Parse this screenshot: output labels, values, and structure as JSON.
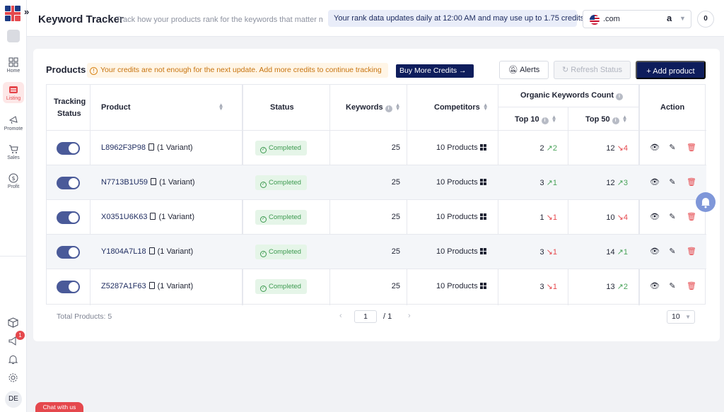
{
  "app": {
    "title": "Keyword Tracker",
    "subtitle": "Track how your products rank for the keywords that matter mc",
    "info": "Your rank data updates daily at 12:00 AM and may use up to 1.75 credits.",
    "marketplace": ".com",
    "marketplace_logo": "a",
    "counter": "0"
  },
  "sidebar": {
    "items": [
      {
        "label": "Home",
        "icon": "grid-icon"
      },
      {
        "label": "Listing",
        "icon": "listing-icon",
        "active": true
      },
      {
        "label": "Promote",
        "icon": "megaphone-icon"
      },
      {
        "label": "Sales",
        "icon": "cart-icon"
      },
      {
        "label": "Profit",
        "icon": "dollar-icon"
      }
    ],
    "notification_badge": "1",
    "avatar": "DE"
  },
  "products": {
    "title": "Products",
    "warning": "Your credits are not enough for the next update. Add more credits to continue tracking",
    "buy_credits": "Buy More Credits",
    "alerts": "Alerts",
    "refresh": "Refresh Status",
    "add_product": "Add product"
  },
  "table": {
    "headers": {
      "tracking": "Tracking",
      "tracking2": "Status",
      "product": "Product",
      "status": "Status",
      "keywords": "Keywords",
      "competitors": "Competitors",
      "organic": "Organic Keywords Count",
      "top10": "Top 10",
      "top50": "Top 50",
      "action": "Action"
    },
    "rows": [
      {
        "sku": "L8962F3P98",
        "variant": "(1 Variant)",
        "status": "Completed",
        "keywords": "25",
        "competitors": "10 Products",
        "top10": "2",
        "top10_delta": "2",
        "top10_dir": "up",
        "top50": "12",
        "top50_delta": "4",
        "top50_dir": "down"
      },
      {
        "sku": "N7713B1U59",
        "variant": "(1 Variant)",
        "status": "Completed",
        "keywords": "25",
        "competitors": "10 Products",
        "top10": "3",
        "top10_delta": "1",
        "top10_dir": "up",
        "top50": "12",
        "top50_delta": "3",
        "top50_dir": "up"
      },
      {
        "sku": "X0351U6K63",
        "variant": "(1 Variant)",
        "status": "Completed",
        "keywords": "25",
        "competitors": "10 Products",
        "top10": "1",
        "top10_delta": "1",
        "top10_dir": "down",
        "top50": "10",
        "top50_delta": "4",
        "top50_dir": "down"
      },
      {
        "sku": "Y1804A7L18",
        "variant": "(1 Variant)",
        "status": "Completed",
        "keywords": "25",
        "competitors": "10 Products",
        "top10": "3",
        "top10_delta": "1",
        "top10_dir": "down",
        "top50": "14",
        "top50_delta": "1",
        "top50_dir": "up"
      },
      {
        "sku": "Z5287A1F63",
        "variant": "(1 Variant)",
        "status": "Completed",
        "keywords": "25",
        "competitors": "10 Products",
        "top10": "3",
        "top10_delta": "1",
        "top10_dir": "down",
        "top50": "13",
        "top50_delta": "2",
        "top50_dir": "up"
      }
    ]
  },
  "footer": {
    "total": "Total Products: 5",
    "page": "1",
    "of": "/ 1",
    "per_page": "10"
  },
  "chat": "Chat with us"
}
